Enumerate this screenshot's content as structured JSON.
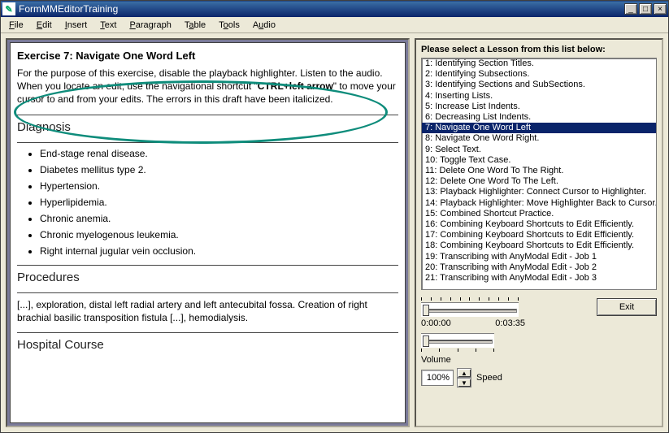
{
  "window": {
    "title": "FormMMEditorTraining",
    "icon_glyph": "✎"
  },
  "menus": [
    "File",
    "Edit",
    "Insert",
    "Text",
    "Paragraph",
    "Table",
    "Tools",
    "Audio"
  ],
  "doc": {
    "exercise_title": "Exercise 7: Navigate One Word Left",
    "intro_pre": "For the purpose of this exercise, disable the playback highlighter.  Listen to the audio.  When you locate an edit, use the navigational shortcut \"",
    "intro_bold": "CTRL+left arrow",
    "intro_post": "\" to move your cursor to and from your edits.  The errors in this draft have been italicized.",
    "section1": "Diagnosis",
    "diag": [
      "End-stage renal disease.",
      "Diabetes mellitus type 2.",
      "Hypertension.",
      "Hyperlipidemia.",
      "Chronic anemia.",
      "Chronic myelogenous leukemia.",
      "Right internal jugular vein occlusion."
    ],
    "section2": "Procedures",
    "proc_text": "[...], exploration, distal left radial artery and left antecubital fossa.  Creation of right brachial basilic transposition fistula [...], hemodialysis.",
    "section3": "Hospital Course"
  },
  "right": {
    "prompt": "Please select a Lesson from this list below:",
    "lessons": [
      "1: Identifying Section Titles.",
      "2: Identifying Subsections.",
      "3: Identifying Sections and SubSections.",
      "4: Inserting Lists.",
      "5: Increase List Indents.",
      "6: Decreasing List Indents.",
      "7: Navigate One Word Left",
      "8: Navigate One Word Right.",
      "9: Select Text.",
      "10: Toggle Text Case.",
      "11: Delete One Word To The Right.",
      "12: Delete One Word To The Left.",
      "13: Playback Highlighter: Connect Cursor to Highlighter.",
      "14: Playback Highlighter: Move Highlighter Back to Cursor.",
      "15: Combined Shortcut Practice.",
      "16: Combining Keyboard Shortcuts to Edit Efficiently.",
      "17: Combining Keyboard Shortcuts to Edit Efficiently.",
      "18: Combining Keyboard Shortcuts to Edit Efficiently.",
      "19: Transcribing with AnyModal Edit - Job 1",
      "20: Transcribing with AnyModal Edit - Job 2",
      "21: Transcribing with AnyModal Edit - Job 3"
    ],
    "selected_index": 6,
    "time_cur": "0:00:00",
    "time_total": "0:03:35",
    "volume_label": "Volume",
    "speed_value": "100%",
    "speed_label": "Speed",
    "exit_label": "Exit"
  },
  "colors": {
    "ellipse": "#0e8c7b",
    "selection": "#0a246a"
  }
}
